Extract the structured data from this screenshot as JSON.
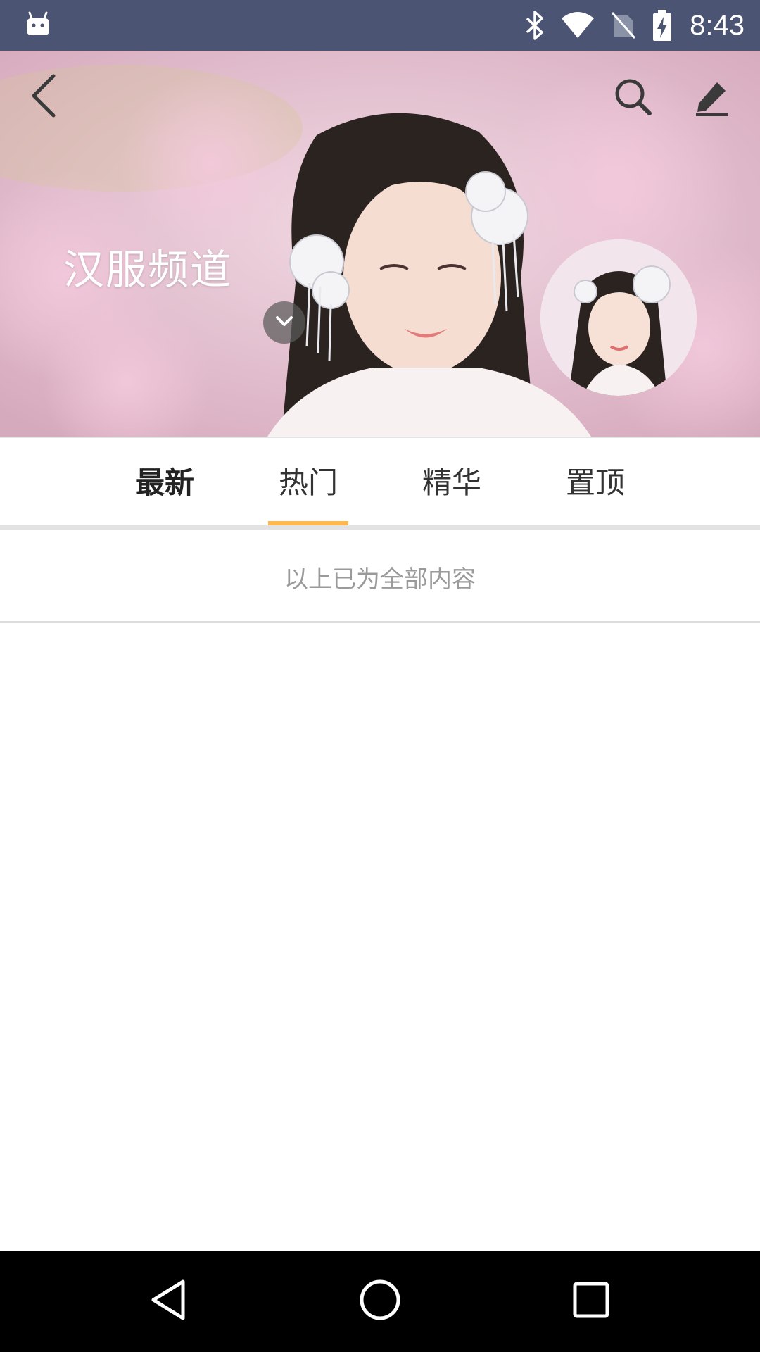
{
  "status_bar": {
    "time": "8:43",
    "icons": [
      "android-notification-icon",
      "bluetooth-icon",
      "wifi-icon",
      "no-sim-icon",
      "battery-charging-icon"
    ]
  },
  "header": {
    "channel_title": "汉服频道",
    "icons": [
      "back-arrow-icon",
      "search-icon",
      "edit-pencil-icon",
      "chevron-down-icon"
    ]
  },
  "tabs": [
    {
      "label": "最新",
      "bold": true
    },
    {
      "label": "热门",
      "selected": true
    },
    {
      "label": "精华"
    },
    {
      "label": "置顶"
    }
  ],
  "content": {
    "end_message": "以上已为全部内容"
  },
  "nav_bar": {
    "icons": [
      "nav-back-icon",
      "nav-home-icon",
      "nav-recents-icon"
    ]
  },
  "colors": {
    "status_bar_bg": "#4b5573",
    "tab_indicator": "#ffb84d",
    "end_text": "#9a9a9a"
  }
}
